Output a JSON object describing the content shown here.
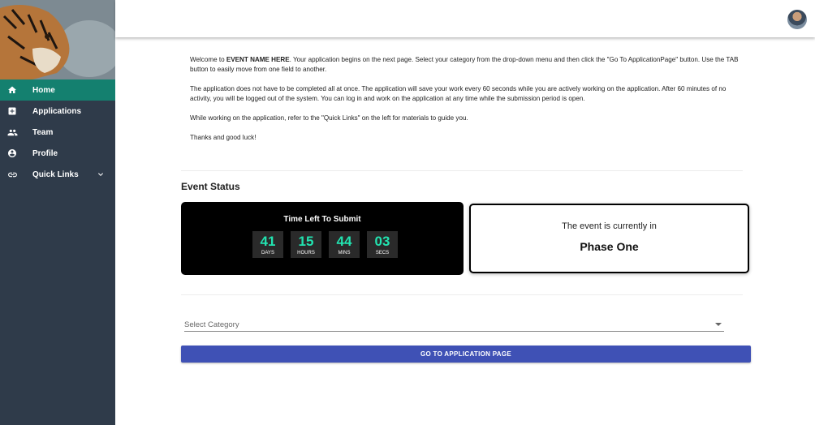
{
  "sidebar": {
    "items": [
      {
        "label": "Home",
        "icon": "home-icon",
        "active": true
      },
      {
        "label": "Applications",
        "icon": "applications-icon",
        "active": false
      },
      {
        "label": "Team",
        "icon": "team-icon",
        "active": false
      },
      {
        "label": "Profile",
        "icon": "profile-icon",
        "active": false
      },
      {
        "label": "Quick Links",
        "icon": "link-icon",
        "active": false
      }
    ]
  },
  "intro": {
    "p1_pre": "Welcome to ",
    "p1_bold": "EVENT NAME HERE",
    "p1_post": ". Your application begins on the next page. Select your category from the drop-down menu and then click the \"Go To ApplicationPage\" button. Use the TAB button to easily move from one field to another.",
    "p2": "The application does not have to be completed all at once. The application will save your work every 60 seconds while you are actively working on the application. After 60 minutes of no activity, you will be logged out of the system. You can log in and work on the application at any time while the submission period is open.",
    "p3": "While working on the application, refer to the \"Quick Links\" on the left for materials to guide you.",
    "p4": "Thanks and good luck!"
  },
  "status": {
    "title": "Event Status",
    "timer_title": "Time Left To Submit",
    "days": "41",
    "days_label": "DAYS",
    "hours": "15",
    "hours_label": "HOURS",
    "mins": "44",
    "mins_label": "MINS",
    "secs": "03",
    "secs_label": "SECS",
    "phase_label": "The event is currently in",
    "phase_value": "Phase One"
  },
  "form": {
    "select_placeholder": "Select Category",
    "button_label": "GO TO APPLICATION PAGE"
  },
  "colors": {
    "sidebar_bg": "#2f3b4a",
    "active_nav": "#14806f",
    "accent_button": "#3f51b5",
    "timer_digits": "#22e3b0"
  }
}
